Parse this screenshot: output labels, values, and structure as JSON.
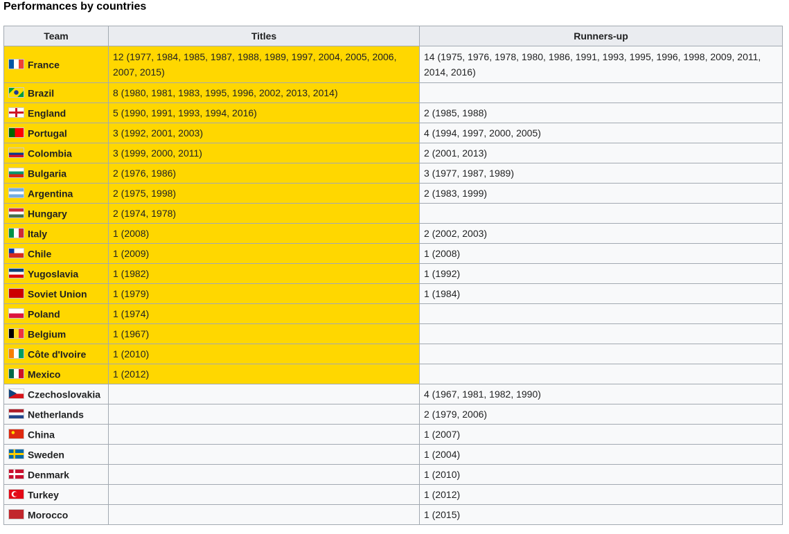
{
  "heading": "Performances by countries",
  "table": {
    "columns": [
      "Team",
      "Titles",
      "Runners-up"
    ],
    "rows": [
      {
        "team": "France",
        "flag": "france-flag-icon",
        "titles": "12 (1977, 1984, 1985, 1987, 1988, 1989, 1997, 2004, 2005, 2006, 2007, 2015)",
        "runners_up": "14 (1975, 1976, 1978, 1980, 1986, 1991, 1993, 1995, 1996, 1998, 2009, 2011, 2014, 2016)"
      },
      {
        "team": "Brazil",
        "flag": "brazil-flag-icon",
        "titles": "8 (1980, 1981, 1983, 1995, 1996, 2002, 2013, 2014)",
        "runners_up": ""
      },
      {
        "team": "England",
        "flag": "england-flag-icon",
        "titles": "5 (1990, 1991, 1993, 1994, 2016)",
        "runners_up": "2 (1985, 1988)"
      },
      {
        "team": "Portugal",
        "flag": "portugal-flag-icon",
        "titles": "3 (1992, 2001, 2003)",
        "runners_up": "4 (1994, 1997, 2000, 2005)"
      },
      {
        "team": "Colombia",
        "flag": "colombia-flag-icon",
        "titles": "3 (1999, 2000, 2011)",
        "runners_up": "2 (2001, 2013)"
      },
      {
        "team": "Bulgaria",
        "flag": "bulgaria-flag-icon",
        "titles": "2 (1976, 1986)",
        "runners_up": "3 (1977, 1987, 1989)"
      },
      {
        "team": "Argentina",
        "flag": "argentina-flag-icon",
        "titles": "2 (1975, 1998)",
        "runners_up": "2 (1983, 1999)"
      },
      {
        "team": "Hungary",
        "flag": "hungary-flag-icon",
        "titles": "2 (1974, 1978)",
        "runners_up": ""
      },
      {
        "team": "Italy",
        "flag": "italy-flag-icon",
        "titles": "1 (2008)",
        "runners_up": "2 (2002, 2003)"
      },
      {
        "team": "Chile",
        "flag": "chile-flag-icon",
        "titles": "1 (2009)",
        "runners_up": "1 (2008)"
      },
      {
        "team": "Yugoslavia",
        "flag": "yugoslavia-flag-icon",
        "titles": "1 (1982)",
        "runners_up": "1 (1992)"
      },
      {
        "team": "Soviet Union",
        "flag": "soviet-union-flag-icon",
        "titles": "1 (1979)",
        "runners_up": "1 (1984)"
      },
      {
        "team": "Poland",
        "flag": "poland-flag-icon",
        "titles": "1 (1974)",
        "runners_up": ""
      },
      {
        "team": "Belgium",
        "flag": "belgium-flag-icon",
        "titles": "1 (1967)",
        "runners_up": ""
      },
      {
        "team": "Côte d'Ivoire",
        "flag": "cote-divoire-flag-icon",
        "titles": "1 (2010)",
        "runners_up": ""
      },
      {
        "team": "Mexico",
        "flag": "mexico-flag-icon",
        "titles": "1 (2012)",
        "runners_up": ""
      },
      {
        "team": "Czechoslovakia",
        "flag": "czechoslovakia-flag-icon",
        "titles": "",
        "runners_up": "4 (1967, 1981, 1982, 1990)"
      },
      {
        "team": "Netherlands",
        "flag": "netherlands-flag-icon",
        "titles": "",
        "runners_up": "2 (1979, 2006)"
      },
      {
        "team": "China",
        "flag": "china-flag-icon",
        "titles": "",
        "runners_up": "1 (2007)"
      },
      {
        "team": "Sweden",
        "flag": "sweden-flag-icon",
        "titles": "",
        "runners_up": "1 (2004)"
      },
      {
        "team": "Denmark",
        "flag": "denmark-flag-icon",
        "titles": "",
        "runners_up": "1 (2010)"
      },
      {
        "team": "Turkey",
        "flag": "turkey-flag-icon",
        "titles": "",
        "runners_up": "1 (2012)"
      },
      {
        "team": "Morocco",
        "flag": "morocco-flag-icon",
        "titles": "",
        "runners_up": "1 (2015)"
      }
    ]
  },
  "colors": {
    "winner_highlight": "#ffd700",
    "header_bg": "#eaecf0",
    "cell_bg": "#f8f9fa",
    "border": "#a2a9b1"
  }
}
